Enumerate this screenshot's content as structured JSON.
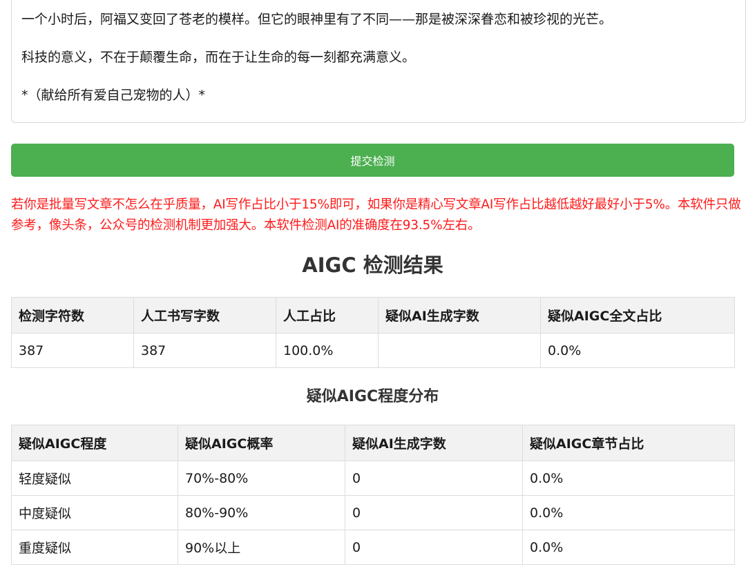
{
  "article": {
    "paragraphs": [
      "一个小时后，阿福又变回了苍老的模样。但它的眼神里有了不同——那是被深深眷恋和被珍视的光芒。",
      "科技的意义，不在于颠覆生命，而在于让生命的每一刻都充满意义。",
      "*（献给所有爱自己宠物的人）*"
    ]
  },
  "submit_label": "提交检测",
  "notice": "若你是批量写文章不怎么在乎质量，AI写作占比小于15%即可，如果你是精心写文章AI写作占比越低越好最好小于5%。本软件只做参考，像头条，公众号的检测机制更加强大。本软件检测AI的准确度在93.5%左右。",
  "results": {
    "title": "AIGC 检测结果",
    "headers": [
      "检测字符数",
      "人工书写字数",
      "人工占比",
      "疑似AI生成字数",
      "疑似AIGC全文占比"
    ],
    "row": [
      "387",
      "387",
      "100.0%",
      "",
      "0.0%"
    ]
  },
  "distribution": {
    "title": "疑似AIGC程度分布",
    "headers": [
      "疑似AIGC程度",
      "疑似AIGC概率",
      "疑似AI生成字数",
      "疑似AIGC章节占比"
    ],
    "rows": [
      [
        "轻度疑似",
        "70%-80%",
        "0",
        "0.0%"
      ],
      [
        "中度疑似",
        "80%-90%",
        "0",
        "0.0%"
      ],
      [
        "重度疑似",
        "90%以上",
        "0",
        "0.0%"
      ]
    ]
  },
  "colors": {
    "button": "#4caf50",
    "notice": "#ff1a1a",
    "header_bg": "#f2f2f2"
  }
}
